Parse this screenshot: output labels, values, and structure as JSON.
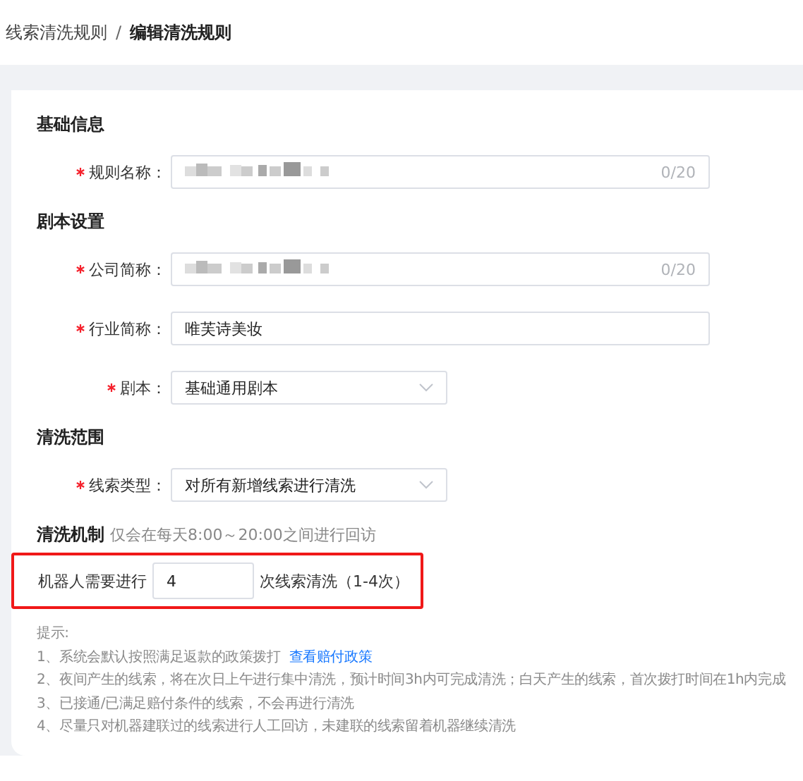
{
  "breadcrumb": [
    {
      "label": "线索清洗规则",
      "current": false
    },
    {
      "label": "编辑清洗规则",
      "current": true
    }
  ],
  "breadcrumb_separator": "/",
  "sections": [
    {
      "title": "基础信息",
      "fields": [
        {
          "kind": "text",
          "label": "规则名称：",
          "required": true,
          "redacted": true,
          "counter": "0/20"
        }
      ]
    },
    {
      "title": "剧本设置",
      "fields": [
        {
          "kind": "text",
          "label": "公司简称：",
          "required": true,
          "redacted": true,
          "counter": "0/20"
        },
        {
          "kind": "text",
          "label": "行业简称：",
          "required": true,
          "value": "唯芙诗美妆"
        },
        {
          "kind": "select",
          "label": "剧本：",
          "required": true,
          "value": "基础通用剧本"
        }
      ]
    },
    {
      "title": "清洗范围",
      "fields": [
        {
          "kind": "select",
          "label": "线索类型：",
          "required": true,
          "value": "对所有新增线索进行清洗"
        }
      ]
    }
  ],
  "mechanism": {
    "title": "清洗机制",
    "note": "仅会在每天8:00～20:00之间进行回访",
    "prefix": "机器人需要进行",
    "value": "4",
    "suffix": "次线索清洗（1-4次）",
    "highlighted": true
  },
  "tips": {
    "title": "提示:",
    "items": [
      {
        "text": "1、系统会默认按照满足返款的政策拨打",
        "link": "查看赔付政策"
      },
      {
        "text": "2、夜间产生的线索，将在次日上午进行集中清洗，预计时间3h内可完成清洗；白天产生的线索，首次拨打时间在1h内完成"
      },
      {
        "text": "3、已接通/已满足赔付条件的线索，不会再进行清洗"
      },
      {
        "text": "4、尽量只对机器建联过的线索进行人工回访，未建联的线索留着机器继续清洗"
      }
    ]
  }
}
